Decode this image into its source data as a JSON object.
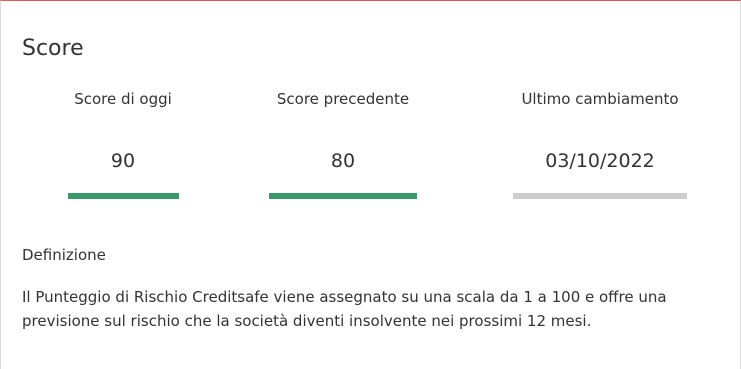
{
  "card": {
    "title": "Score",
    "metrics": [
      {
        "label": "Score di oggi",
        "value": "90",
        "bar_color": "#3a9a6a"
      },
      {
        "label": "Score precedente",
        "value": "80",
        "bar_color": "#3a9a6a"
      },
      {
        "label": "Ultimo cambiamento",
        "value": "03/10/2022",
        "bar_color": "#cccccc"
      }
    ],
    "definition": {
      "heading": "Definizione",
      "text": "Il Punteggio di Rischio Creditsafe viene assegnato su una scala da 1 a 100 e offre una previsione sul rischio che la società diventi insolvente nei prossimi 12 mesi."
    }
  },
  "colors": {
    "accent_border": "#e05a5a",
    "good": "#3a9a6a",
    "neutral": "#cccccc"
  }
}
